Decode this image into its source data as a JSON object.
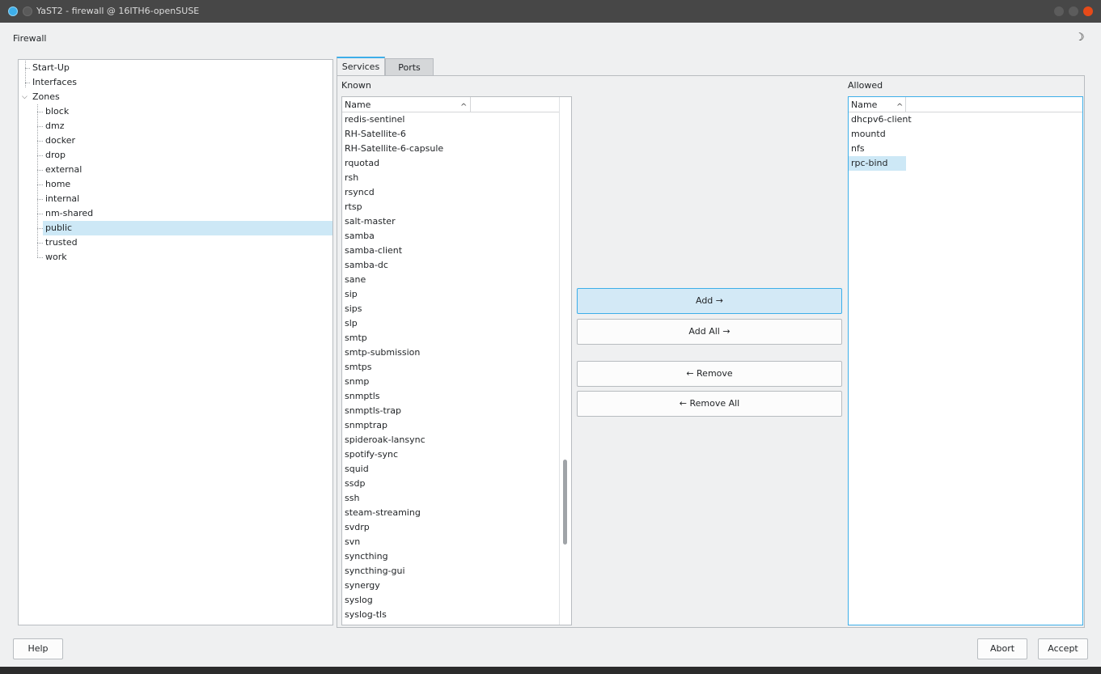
{
  "window": {
    "title": "YaST2 - firewall @ 16ITH6-openSUSE"
  },
  "heading": "Firewall",
  "theme_icon": "moon-icon",
  "tree": {
    "items": [
      {
        "label": "Start-Up",
        "level": 0
      },
      {
        "label": "Interfaces",
        "level": 0
      },
      {
        "label": "Zones",
        "level": 0,
        "expanded": true
      },
      {
        "label": "block",
        "level": 1
      },
      {
        "label": "dmz",
        "level": 1
      },
      {
        "label": "docker",
        "level": 1
      },
      {
        "label": "drop",
        "level": 1
      },
      {
        "label": "external",
        "level": 1
      },
      {
        "label": "home",
        "level": 1
      },
      {
        "label": "internal",
        "level": 1
      },
      {
        "label": "nm-shared",
        "level": 1
      },
      {
        "label": "public",
        "level": 1,
        "selected": true
      },
      {
        "label": "trusted",
        "level": 1
      },
      {
        "label": "work",
        "level": 1
      }
    ]
  },
  "tabs": [
    {
      "label": "Services",
      "active": true
    },
    {
      "label": "Ports",
      "active": false
    }
  ],
  "known": {
    "label": "Known",
    "column": "Name",
    "items": [
      "redis-sentinel",
      "RH-Satellite-6",
      "RH-Satellite-6-capsule",
      "rquotad",
      "rsh",
      "rsyncd",
      "rtsp",
      "salt-master",
      "samba",
      "samba-client",
      "samba-dc",
      "sane",
      "sip",
      "sips",
      "slp",
      "smtp",
      "smtp-submission",
      "smtps",
      "snmp",
      "snmptls",
      "snmptls-trap",
      "snmptrap",
      "spideroak-lansync",
      "spotify-sync",
      "squid",
      "ssdp",
      "ssh",
      "steam-streaming",
      "svdrp",
      "svn",
      "syncthing",
      "syncthing-gui",
      "synergy",
      "syslog",
      "syslog-tls"
    ]
  },
  "allowed": {
    "label": "Allowed",
    "column": "Name",
    "items": [
      "dhcpv6-client",
      "mountd",
      "nfs",
      "rpc-bind"
    ],
    "selected": "rpc-bind"
  },
  "buttons": {
    "add": "Add →",
    "add_all": "Add All →",
    "remove": "← Remove",
    "remove_all": "← Remove All",
    "help": "Help",
    "abort": "Abort",
    "accept": "Accept"
  },
  "colors": {
    "accent": "#3daee9",
    "selection": "#cde8f6",
    "titlebar": "#474747",
    "close": "#e64a19"
  }
}
